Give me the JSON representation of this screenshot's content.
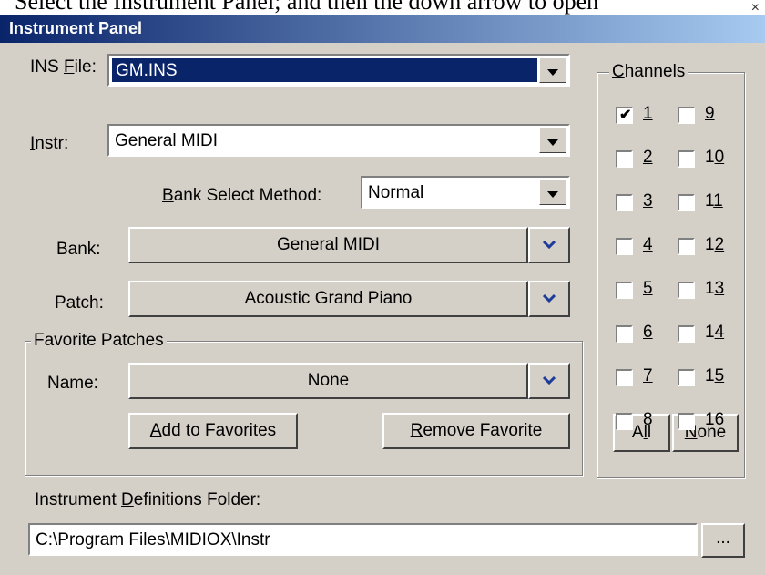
{
  "top_text": "Select the Instrument Panel; and then the down arrow to open",
  "window": {
    "title": "Instrument Panel",
    "close_glyph": "×"
  },
  "ins_file": {
    "label_pre": "INS ",
    "label_ul": "F",
    "label_post": "ile:",
    "value": "GM.INS"
  },
  "instr": {
    "label_ul": "I",
    "label_post": "nstr:",
    "value": "General MIDI"
  },
  "bank_select": {
    "label_ul": "B",
    "label_post": "ank Select Method:",
    "value": "Normal"
  },
  "bank": {
    "label": "Bank:",
    "value": "General MIDI"
  },
  "patch": {
    "label": "Patch:",
    "value": "Acoustic Grand Piano"
  },
  "favorites": {
    "group_label": "Favorite Patches",
    "name_label": "Name:",
    "name_value": "None",
    "add_ul": "A",
    "add_post": "dd to Favorites",
    "remove_ul": "R",
    "remove_post": "emove Favorite"
  },
  "channels": {
    "group_ul": "C",
    "group_post": "hannels",
    "items": [
      {
        "n": "1",
        "checked": true
      },
      {
        "n": "2",
        "checked": false
      },
      {
        "n": "3",
        "checked": false
      },
      {
        "n": "4",
        "checked": false
      },
      {
        "n": "5",
        "checked": false
      },
      {
        "n": "6",
        "checked": false
      },
      {
        "n": "7",
        "checked": false
      },
      {
        "n": "8",
        "checked": false
      },
      {
        "n": "9",
        "checked": false
      },
      {
        "n": "10",
        "checked": false
      },
      {
        "n": "11",
        "checked": false
      },
      {
        "n": "12",
        "checked": false
      },
      {
        "n": "13",
        "checked": false
      },
      {
        "n": "14",
        "checked": false
      },
      {
        "n": "15",
        "checked": false
      },
      {
        "n": "16",
        "checked": false
      }
    ],
    "all_pre": "A",
    "all_ul": "l",
    "all_post": "l",
    "none_ul": "N",
    "none_post": "one"
  },
  "folder": {
    "label_pre": "Instrument ",
    "label_ul": "D",
    "label_post": "efinitions Folder:",
    "value": "C:\\Program Files\\MIDIOX\\Instr",
    "browse_label": "..."
  },
  "colors": {
    "accent": "#0a246a",
    "chevron": "#1d3c9a",
    "face": "#d4d0c8"
  }
}
